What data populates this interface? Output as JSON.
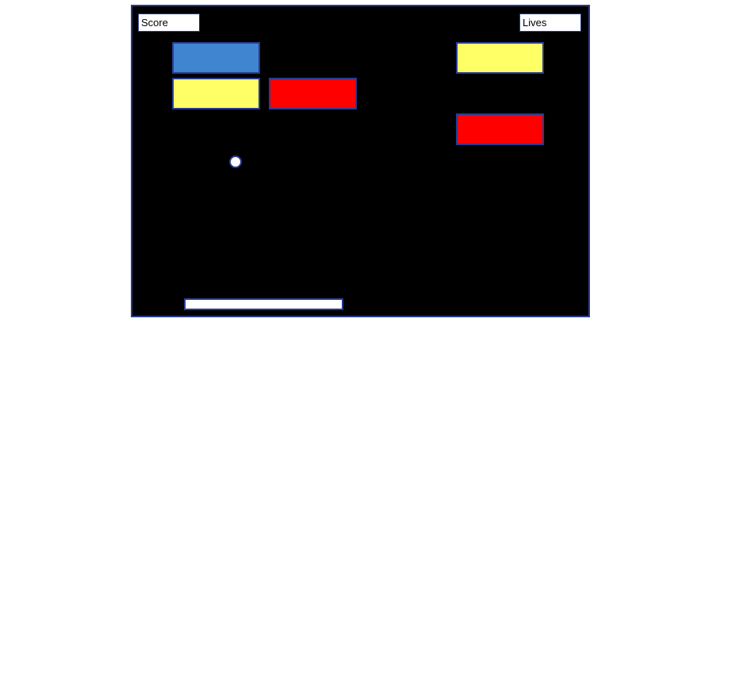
{
  "hud": {
    "score_label": "Score",
    "lives_label": "Lives"
  },
  "colors": {
    "background": "#000000",
    "border": "#2a3b8f",
    "blue": "#3f85cf",
    "yellow": "#ffff66",
    "red": "#ff0000",
    "ball": "#ffffff",
    "paddle": "#ffffff"
  },
  "bricks": [
    {
      "color": "blue"
    },
    {
      "color": "yellow"
    },
    {
      "color": "red"
    },
    {
      "color": "yellow"
    },
    {
      "color": "red"
    }
  ]
}
